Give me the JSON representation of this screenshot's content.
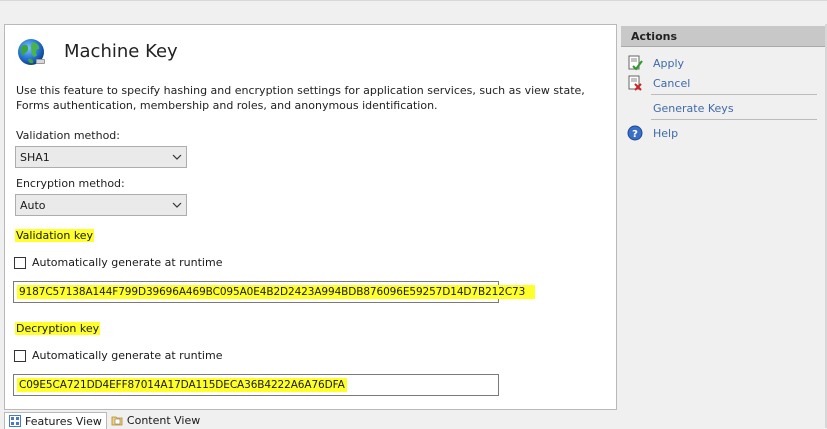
{
  "page": {
    "title": "Machine Key",
    "description": "Use this feature to specify hashing and encryption settings for application services, such as view state, Forms authentication, membership and roles, and anonymous identification."
  },
  "validation_method": {
    "label": "Validation method:",
    "value": "SHA1"
  },
  "encryption_method": {
    "label": "Encryption method:",
    "value": "Auto"
  },
  "validation_key": {
    "label": "Validation key",
    "auto_generate_label": "Automatically generate at runtime",
    "auto_generate_checked": false,
    "value": "9187C57138A144F799D39696A469BC095A0E4B2D2423A994BDB876096E59257D14D7B212C73"
  },
  "decryption_key": {
    "label": "Decryption key",
    "auto_generate_label": "Automatically generate at runtime",
    "auto_generate_checked": false,
    "value": "C09E5CA721DD4EFF87014A17DA115DECA36B4222A6A76DFA"
  },
  "bottom_tabs": [
    {
      "label": "Features View",
      "active": true
    },
    {
      "label": "Content View",
      "active": false
    }
  ],
  "actions": {
    "header": "Actions",
    "items": [
      {
        "label": "Apply",
        "icon": "apply-icon"
      },
      {
        "label": "Cancel",
        "icon": "cancel-icon"
      },
      {
        "label": "Generate Keys",
        "icon": ""
      },
      {
        "label": "Help",
        "icon": "help-icon"
      }
    ]
  },
  "colors": {
    "highlight": "#ffff29",
    "link": "#3f6aa8",
    "header_bg": "#c8c8c8"
  }
}
